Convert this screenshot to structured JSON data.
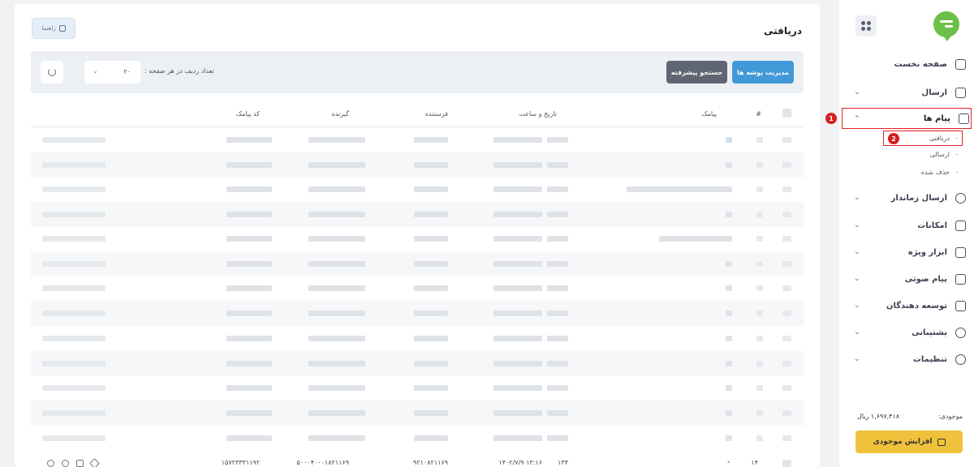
{
  "sidebar": {
    "items": [
      {
        "label": "صفحه نخست",
        "icon": "home-icon",
        "expandable": false
      },
      {
        "label": "ارسال",
        "icon": "send-box-icon",
        "expandable": true
      },
      {
        "label": "پیام ها",
        "icon": "messages-icon",
        "expandable": true,
        "active": true
      },
      {
        "label": "ارسال زماندار",
        "icon": "timer-icon",
        "expandable": true
      },
      {
        "label": "امکانات",
        "icon": "sliders-icon",
        "expandable": true
      },
      {
        "label": "ابزار ویژه",
        "icon": "star-icon",
        "expandable": true
      },
      {
        "label": "پیام صوتی",
        "icon": "speaker-icon",
        "expandable": true
      },
      {
        "label": "توسعه دهندگان",
        "icon": "code-icon",
        "expandable": true
      },
      {
        "label": "پشتیبانی",
        "icon": "support-icon",
        "expandable": true
      },
      {
        "label": "تنظیمات",
        "icon": "gear-icon",
        "expandable": true
      }
    ],
    "subitems": [
      "دریافتی",
      "ارسالی",
      "حذف شده"
    ],
    "balance_label": "موجودی:",
    "balance_value": "۱,۶۹۷,۴۱۸ ریال",
    "topup_label": "افزایش موجودی",
    "annotations": [
      "1",
      "2"
    ],
    "accent_red": "#e02424"
  },
  "main": {
    "title": "دریافتی",
    "help_label": "راهنما",
    "manage_label": "مدیریت پوشه ها",
    "search_label": "جستجو پیشرفته",
    "rows_label": "تعداد ردیف در هر صفحه :",
    "rows_value": "۲۰",
    "columns": [
      "#",
      "پیامک",
      "تاریخ و ساعت",
      "فرستنده",
      "گیرنده",
      "کد پیامک"
    ],
    "last_row": {
      "index": "۱۴",
      "datetime": "۱۴۰۲/۷/۹ ۱۳:۱۶",
      "time_extra": "۱۳۳",
      "sender": "۹۲۱۰۸۲۱۱۶۹",
      "receiver": "۵۰۰۰۴۰۰۰۱۸۲۱۱۶۹",
      "code": "۱۵۷۲۳۳۳۱۱۹۲"
    },
    "colors": {
      "primary": "#4299d8",
      "secondary": "#5f6672",
      "accent_yellow": "#f0c23b"
    }
  }
}
